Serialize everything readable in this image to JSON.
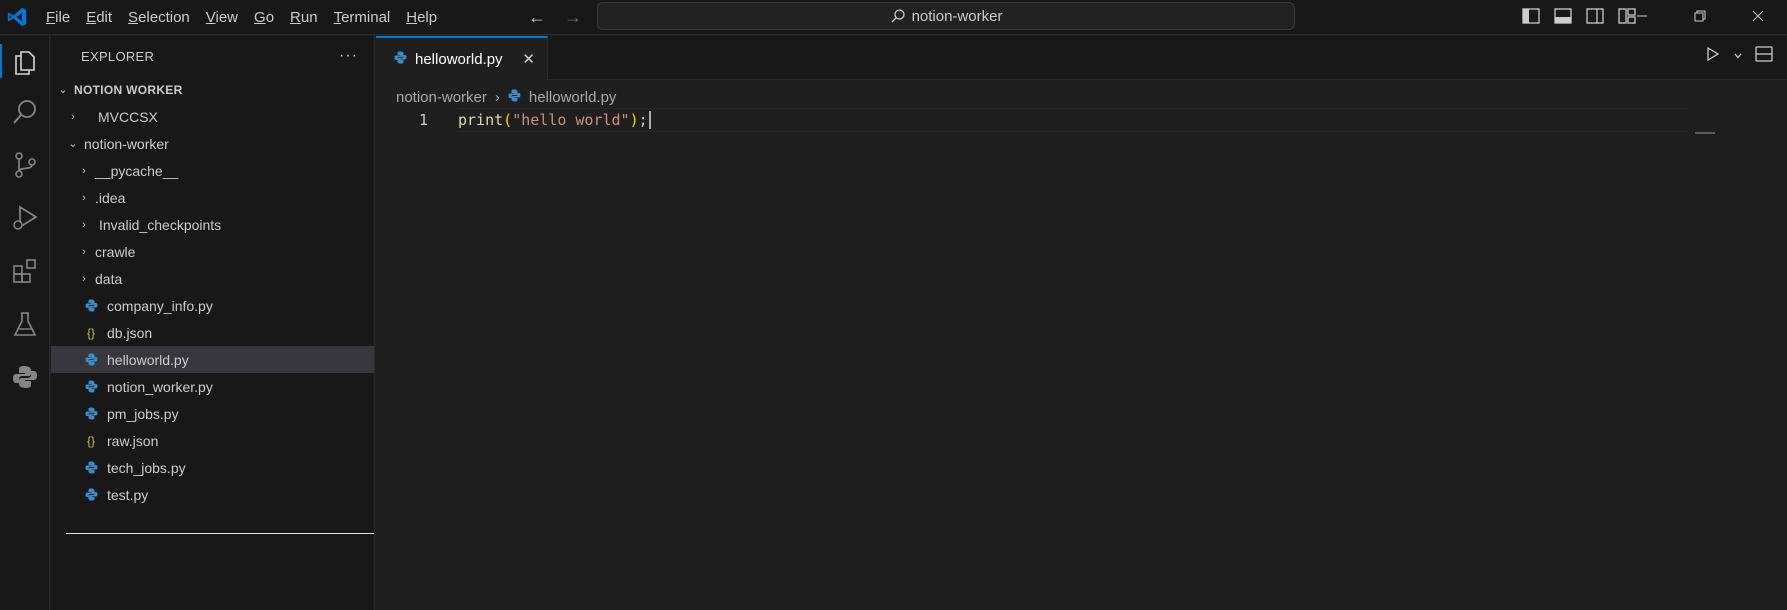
{
  "titlebar": {
    "menu": [
      {
        "label": "File",
        "underline": "F",
        "rest": "ile"
      },
      {
        "label": "Edit",
        "underline": "E",
        "rest": "dit"
      },
      {
        "label": "Selection",
        "underline": "S",
        "rest": "election"
      },
      {
        "label": "View",
        "underline": "V",
        "rest": "iew"
      },
      {
        "label": "Go",
        "underline": "G",
        "rest": "o"
      },
      {
        "label": "Run",
        "underline": "R",
        "rest": "un"
      },
      {
        "label": "Terminal",
        "underline": "T",
        "rest": "erminal"
      },
      {
        "label": "Help",
        "underline": "H",
        "rest": "elp"
      }
    ],
    "search_text": "notion-worker",
    "accent_color": "#0078d4"
  },
  "sidebar": {
    "title": "EXPLORER",
    "more": "···",
    "tree": [
      {
        "label": "NOTION WORKER",
        "chev": "⌄"
      },
      {
        "label": "MVCCSX",
        "chev": "›"
      },
      {
        "label": "notion-worker",
        "chev": "⌄"
      },
      {
        "label": "__pycache__",
        "chev": "›"
      },
      {
        "label": ".idea",
        "chev": "›"
      },
      {
        "label": "Invalid_checkpoints",
        "chev": "›"
      },
      {
        "label": "crawle",
        "chev": "›"
      },
      {
        "label": "data",
        "chev": "›"
      },
      {
        "label": "company_info.py",
        "icon": "python-icon"
      },
      {
        "label": "db.json",
        "icon": "json-icon"
      },
      {
        "label": "helloworld.py",
        "icon": "python-icon"
      },
      {
        "label": "notion_worker.py",
        "icon": "python-icon"
      },
      {
        "label": "pm_jobs.py",
        "icon": "python-icon"
      },
      {
        "label": "raw.json",
        "icon": "json-icon"
      },
      {
        "label": "tech_jobs.py",
        "icon": "python-icon"
      },
      {
        "label": "test.py",
        "icon": "python-icon"
      }
    ]
  },
  "editor": {
    "tab_label": "helloworld.py",
    "tab_close": "✕",
    "breadcrumb": {
      "folder": "notion-worker",
      "separator": "›",
      "file": "helloworld.py"
    },
    "lines": [
      {
        "number": "1",
        "fn": "print",
        "open": "(",
        "str": "\"hello world\"",
        "close": ")",
        "semi": ";"
      }
    ]
  }
}
